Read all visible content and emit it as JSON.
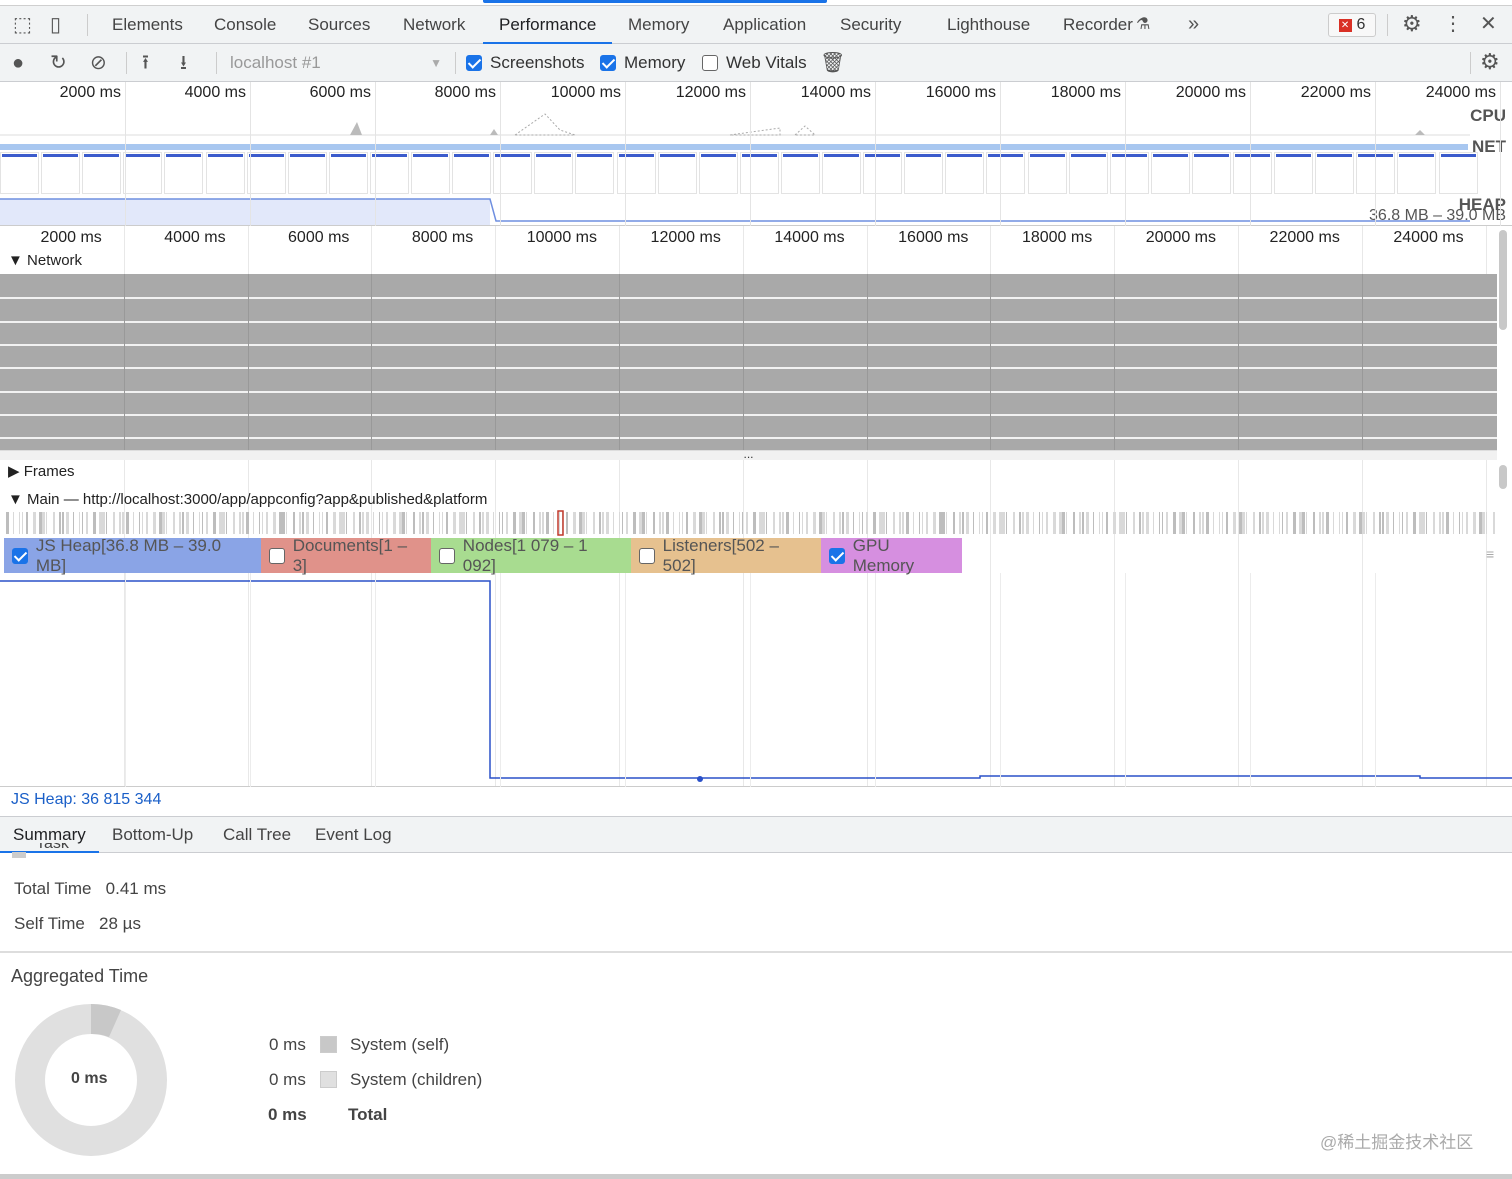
{
  "tabs": [
    "Elements",
    "Console",
    "Sources",
    "Network",
    "Performance",
    "Memory",
    "Application",
    "Security",
    "Lighthouse",
    "Recorder"
  ],
  "active_tab": "Performance",
  "error_count": "6",
  "toolbar": {
    "target": "localhost #1",
    "screenshots": "Screenshots",
    "screenshots_checked": true,
    "memory": "Memory",
    "memory_checked": true,
    "web_vitals": "Web Vitals",
    "web_vitals_checked": false
  },
  "ruler_ticks": [
    "2000 ms",
    "4000 ms",
    "6000 ms",
    "8000 ms",
    "10000 ms",
    "12000 ms",
    "14000 ms",
    "16000 ms",
    "18000 ms",
    "20000 ms",
    "22000 ms",
    "24000 ms"
  ],
  "overview": {
    "cpu": "CPU",
    "net": "NET",
    "heap": "HEAP",
    "heap_range": "36.8 MB – 39.0 MB"
  },
  "tracks": {
    "network": "Network",
    "frames": "Frames",
    "main": "Main — http://localhost:3000/app/appconfig?app&published&platform",
    "more": "..."
  },
  "counters": [
    {
      "label": "JS Heap[36.8 MB – 39.0 MB]",
      "checked": true,
      "color": "#8aa4e6"
    },
    {
      "label": "Documents[1 – 3]",
      "checked": false,
      "color": "#e0928a"
    },
    {
      "label": "Nodes[1 079 – 1 092]",
      "checked": false,
      "color": "#a8dc90"
    },
    {
      "label": "Listeners[502 – 502]",
      "checked": false,
      "color": "#e6c18f"
    },
    {
      "label": "GPU Memory",
      "checked": true,
      "color": "#d68fe0"
    }
  ],
  "heap_readout": "JS Heap: 36 815 344",
  "bottom_tabs": [
    "Summary",
    "Bottom-Up",
    "Call Tree",
    "Event Log"
  ],
  "summary": {
    "task": "Task",
    "total_time_label": "Total Time",
    "total_time": "0.41 ms",
    "self_time_label": "Self Time",
    "self_time": "28 µs",
    "aggregated_title": "Aggregated Time",
    "donut_center": "0 ms",
    "legend": [
      {
        "value": "0 ms",
        "label": "System (self)",
        "color": "#c8c8c8"
      },
      {
        "value": "0 ms",
        "label": "System (children)",
        "color": "#e0e0e0"
      }
    ],
    "total_value": "0 ms",
    "total_label": "Total"
  },
  "watermark": "@稀土掘金技术社区"
}
